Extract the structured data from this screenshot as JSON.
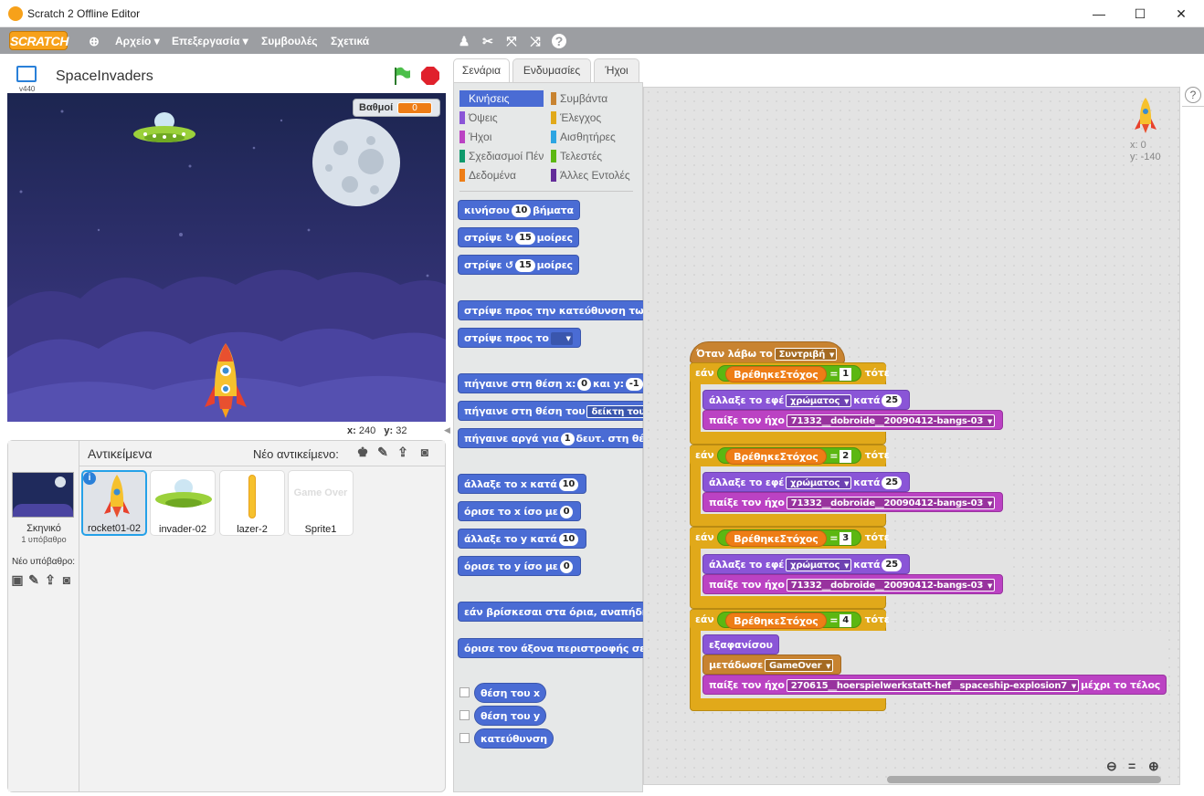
{
  "window": {
    "title": "Scratch 2 Offline Editor",
    "min": "—",
    "max": "☐",
    "close": "✕"
  },
  "menu": {
    "logo": "SCRATCH",
    "file": "Αρχείο ▾",
    "edit": "Επεξεργασία ▾",
    "tips": "Συμβουλές",
    "about": "Σχετικά"
  },
  "project": {
    "name": "SpaceInvaders",
    "version": "v440",
    "score_label": "Βαθμοί",
    "score_value": "0"
  },
  "stage": {
    "x_label": "x:",
    "x": "240",
    "y_label": "y:",
    "y": "32"
  },
  "sprites": {
    "header": "Αντικείμενα",
    "new_label": "Νέο αντικείμενο:",
    "backdrop_title": "Σκηνικό",
    "backdrop_count": "1 υπόβαθρο",
    "new_backdrop": "Νέο υπόβαθρο:",
    "items": [
      {
        "name": "rocket01-02"
      },
      {
        "name": "invader-02"
      },
      {
        "name": "lazer-2"
      },
      {
        "name": "Sprite1",
        "preview": "Game Over"
      }
    ]
  },
  "tabs": {
    "scripts": "Σενάρια",
    "costumes": "Ενδυμασίες",
    "sounds": "Ήχοι"
  },
  "categories": [
    {
      "label": "Κινήσεις",
      "color": "#4a6cd4"
    },
    {
      "label": "Συμβάντα",
      "color": "#c88330"
    },
    {
      "label": "Όψεις",
      "color": "#8a55d7"
    },
    {
      "label": "Έλεγχος",
      "color": "#e1a91a"
    },
    {
      "label": "Ήχοι",
      "color": "#bb42c3"
    },
    {
      "label": "Αισθητήρες",
      "color": "#2ca5e2"
    },
    {
      "label": "Σχεδιασμοί Πένας",
      "color": "#0e9a6c"
    },
    {
      "label": "Τελεστές",
      "color": "#5cb712"
    },
    {
      "label": "Δεδομένα",
      "color": "#ee7d16"
    },
    {
      "label": "Άλλες Εντολές",
      "color": "#632d99"
    }
  ],
  "palette": {
    "move": "κινήσου",
    "move_n": "10",
    "move_unit": "βήματα",
    "turn": "στρίψε",
    "turn_n": "15",
    "turn_unit": "μοίρες",
    "point_dir": "στρίψε προς την κατεύθυνση των",
    "point_to": "στρίψε προς το",
    "goto_xy": "πήγαινε στη θέση x:",
    "goto_x": "0",
    "goto_y_label": "και y:",
    "goto_y": "-1",
    "goto": "πήγαινε στη θέση του",
    "goto_target": "δείκτη του πο",
    "glide": "πήγαινε αργά για",
    "glide_n": "1",
    "glide_rest": "δευτ. στη θέ",
    "change_x": "άλλαξε το x κατά",
    "change_x_n": "10",
    "set_x": "όρισε το x ίσο με",
    "set_x_n": "0",
    "change_y": "άλλαξε το y κατά",
    "change_y_n": "10",
    "set_y": "όρισε το y ίσο με",
    "set_y_n": "0",
    "bounce": "εάν βρίσκεσαι στα όρια, αναπήδησ",
    "rotation": "όρισε τον άξονα περιστροφής σε",
    "xpos": "θέση του x",
    "ypos": "θέση του y",
    "direction": "κατεύθυνση"
  },
  "script": {
    "hat": "Όταν λάβω το",
    "hat_msg": "Συντριβή",
    "if": "εάν",
    "then": "τότε",
    "var": "ΒρέθηκεΣτόχος",
    "eq": "=",
    "effect": "άλλαξε το εφέ",
    "effect_name": "χρώματος",
    "by": "κατά",
    "effect_n": "25",
    "play": "παίξε τον ήχο",
    "sound1": "71332__dobroide__20090412-bangs-03",
    "vals": [
      "1",
      "2",
      "3",
      "4"
    ],
    "hide": "εξαφανίσου",
    "broadcast": "μετάδωσε",
    "broadcast_msg": "GameOver",
    "sound2": "270615__hoerspielwerkstatt-hef__spaceship-explosion7",
    "until_done": "μέχρι το τέλος"
  },
  "sprite_info": {
    "x": "x: 0",
    "y": "y: -140"
  },
  "help": "?"
}
